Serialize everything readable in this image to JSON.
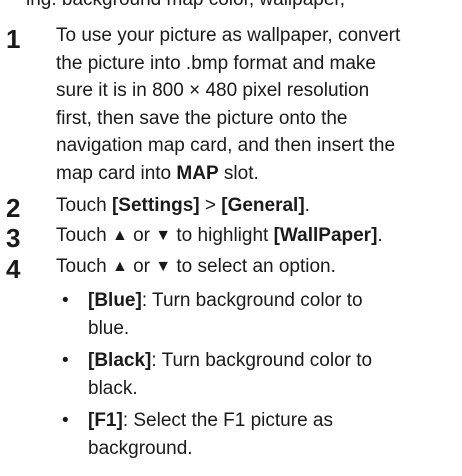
{
  "cut_text": "ing: background map color, wallpaper,",
  "steps": [
    {
      "num": "1",
      "lines": [
        "To use your picture as wallpaper, convert",
        "the picture into .bmp format and make",
        "sure it is in 800 × 480 pixel resolution",
        "first, then save the picture onto the",
        "navigation map card, and then insert the"
      ],
      "last_line_prefix": "map card into ",
      "last_line_bold": "MAP",
      "last_line_suffix": " slot."
    },
    {
      "num": "2",
      "prefix": "Touch ",
      "bold1": "[Settings]",
      "mid": " > ",
      "bold2": "[General]",
      "suffix": "."
    },
    {
      "num": "3",
      "prefix": "Touch ",
      "up": "▲",
      "or": " or ",
      "down": "▼",
      "mid": " to highlight ",
      "bold": "[WallPaper]",
      "suffix": "."
    },
    {
      "num": "4",
      "prefix": "Touch ",
      "up": "▲",
      "or": " or ",
      "down": "▼",
      "suffix": " to select an option."
    }
  ],
  "options": [
    {
      "bullet": "•",
      "label": "[Blue]",
      "desc1": ": Turn background color to",
      "desc2": "blue."
    },
    {
      "bullet": "•",
      "label": "[Black]",
      "desc1": ": Turn background color to",
      "desc2": "black."
    },
    {
      "bullet": "•",
      "label": "[F1]",
      "desc1": ": Select the F1 picture as",
      "desc2": "background."
    }
  ]
}
